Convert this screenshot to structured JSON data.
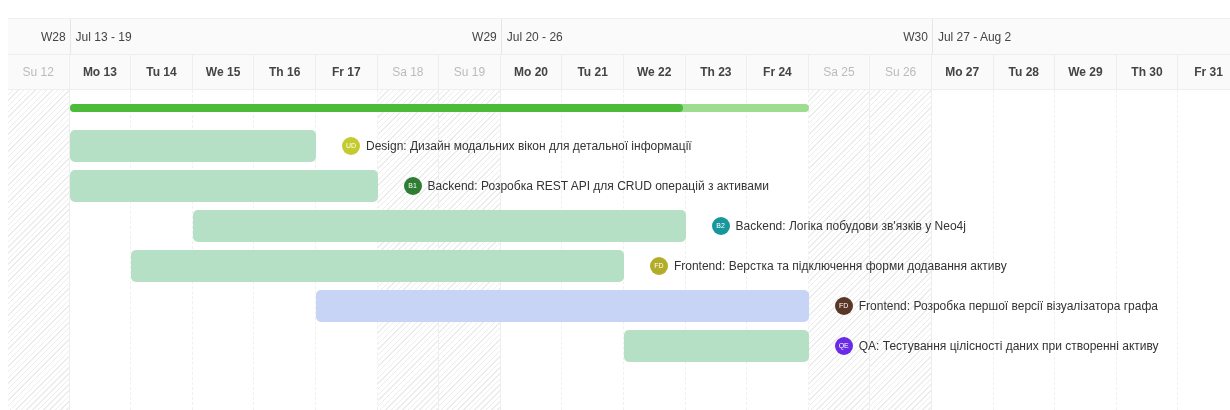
{
  "weeks": [
    {
      "number": "W28",
      "range": "Jul 13 - 19"
    },
    {
      "number": "W29",
      "range": "Jul 20 - 26"
    },
    {
      "number": "W30",
      "range": "Jul 27 - Aug 2"
    }
  ],
  "days": [
    {
      "label": "Su 12",
      "weekend": true
    },
    {
      "label": "Mo 13",
      "weekend": false
    },
    {
      "label": "Tu 14",
      "weekend": false
    },
    {
      "label": "We 15",
      "weekend": false
    },
    {
      "label": "Th 16",
      "weekend": false
    },
    {
      "label": "Fr 17",
      "weekend": false
    },
    {
      "label": "Sa 18",
      "weekend": true
    },
    {
      "label": "Su 19",
      "weekend": true
    },
    {
      "label": "Mo 20",
      "weekend": false
    },
    {
      "label": "Tu 21",
      "weekend": false
    },
    {
      "label": "We 22",
      "weekend": false
    },
    {
      "label": "Th 23",
      "weekend": false
    },
    {
      "label": "Fr 24",
      "weekend": false
    },
    {
      "label": "Sa 25",
      "weekend": true
    },
    {
      "label": "Su 26",
      "weekend": true
    },
    {
      "label": "Mo 27",
      "weekend": false
    },
    {
      "label": "Tu 28",
      "weekend": false
    },
    {
      "label": "We 29",
      "weekend": false
    },
    {
      "label": "Th 30",
      "weekend": false
    },
    {
      "label": "Fr 31",
      "weekend": false
    }
  ],
  "project_progress": {
    "level": 0.83
  },
  "tasks": [
    {
      "avatar": "UD",
      "color": "#c3cc2c",
      "label": "Design: Дизайн модальних вікон для детальної інформації",
      "kind": "green"
    },
    {
      "avatar": "B1",
      "color": "#2e7d32",
      "label": "Backend: Розробка REST API для CRUD операцій з активами",
      "kind": "green"
    },
    {
      "avatar": "B2",
      "color": "#17979b",
      "label": "Backend: Логіка побудови зв'язків у Neo4j",
      "kind": "green"
    },
    {
      "avatar": "FD",
      "color": "#b3ac28",
      "label": "Frontend: Верстка та підключення форми додавання активу",
      "kind": "green"
    },
    {
      "avatar": "FD",
      "color": "#5a3626",
      "label": "Frontend: Розробка першої версії візуалізатора графа",
      "kind": "blue"
    },
    {
      "avatar": "QE",
      "color": "#6a2be6",
      "label": "QA: Тестування цілісності даних при створенні активу",
      "kind": "green"
    }
  ]
}
